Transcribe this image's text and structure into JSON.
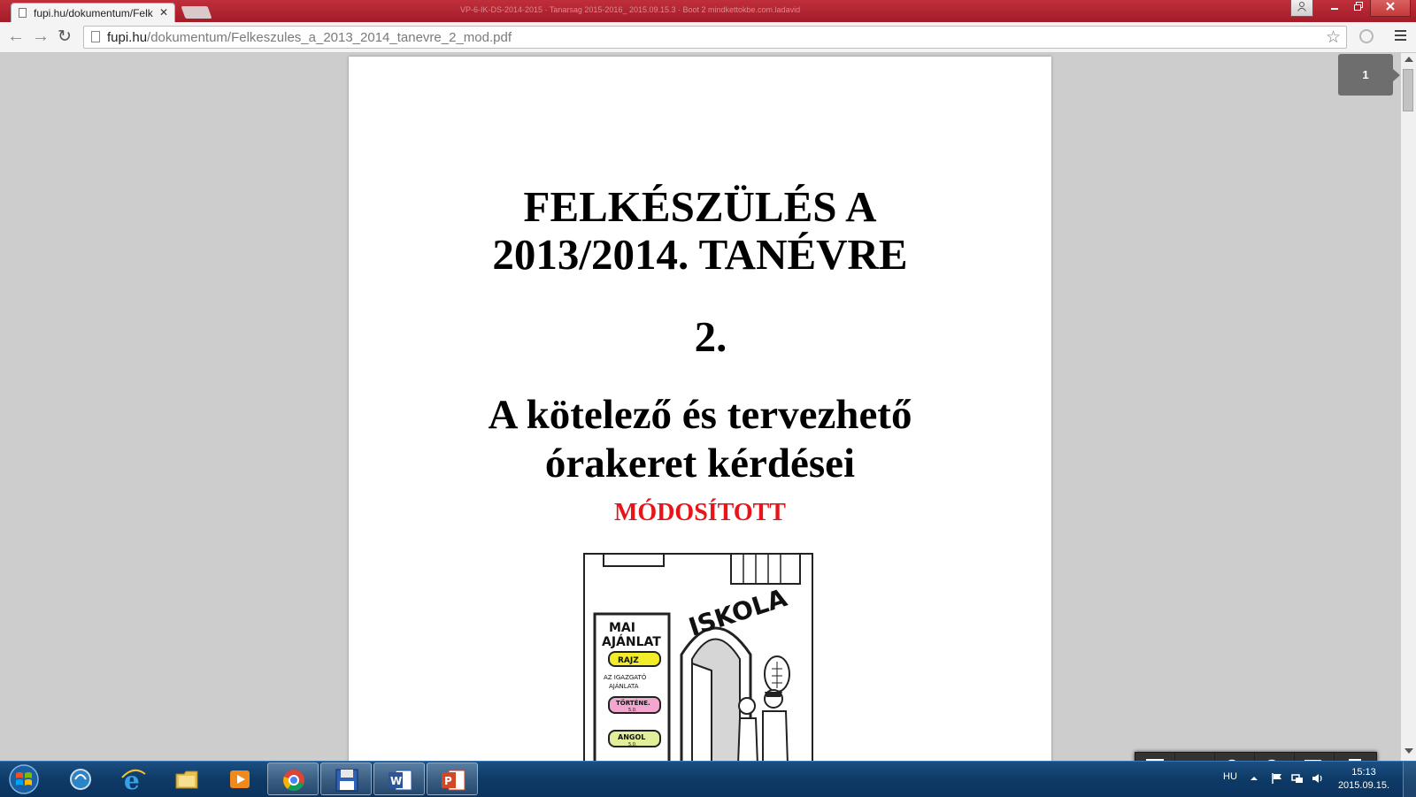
{
  "browser": {
    "tab_title": "fupi.hu/dokumentum/Felk",
    "titlebar_caption": "VP-6-IK-DS-2014-2015 · Tanarsag 2015-2016_ 2015.09.15.3 · Boot 2 mindkettokbe.com.ladavid",
    "url_host": "fupi.hu",
    "url_path": "/dokumentum/Felkeszules_a_2013_2014_tanevre_2_mod.pdf"
  },
  "document": {
    "title_line1": "FELKÉSZÜLÉS A",
    "title_line2": "2013/2014. TANÉVRE",
    "number": "2.",
    "subtitle_line1": "A kötelező és tervezhető",
    "subtitle_line2": "órakeret kérdései",
    "modified": "MÓDOSÍTOTT",
    "cartoon": {
      "school_sign": "ISKOLA",
      "board_title_1": "MAI",
      "board_title_2": "AJÁNLAT",
      "board_item_1": "RAJZ",
      "board_item_2a": "AZ IGAZGATÓ",
      "board_item_2b": "AJÁNLATA",
      "board_item_3": "TÖRTÉNE.",
      "board_item_3b": "5.0.",
      "board_item_4": "ANGOL",
      "board_item_4b": "5.0."
    }
  },
  "viewer": {
    "page_indicator": "1"
  },
  "taskbar": {
    "language": "HU",
    "time": "15:13",
    "date": "2015.09.15."
  },
  "colors": {
    "titlebar": "#a41b28",
    "modified_red": "#e8141a",
    "taskbar": "#0e3a66"
  }
}
